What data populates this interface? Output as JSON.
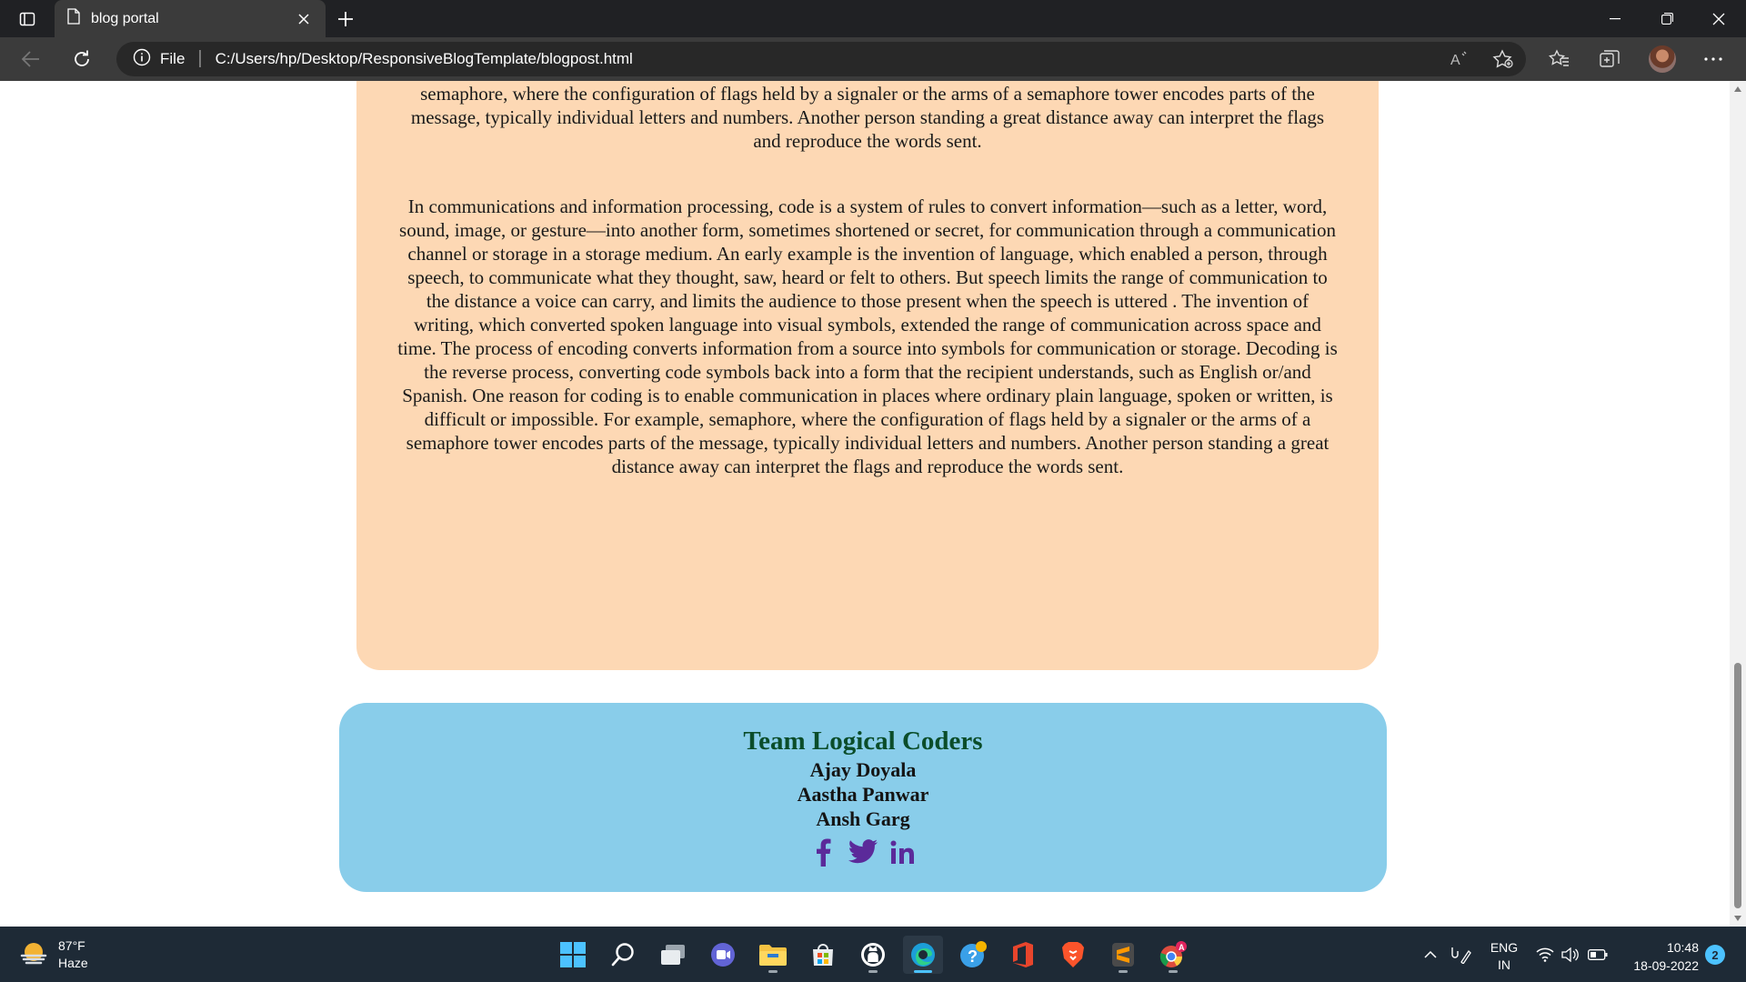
{
  "browser": {
    "tab_title": "blog portal",
    "address_prefix": "File",
    "url": "C:/Users/hp/Desktop/ResponsiveBlogTemplate/blogpost.html"
  },
  "article": {
    "paragraph1": "communication in places where ordinary plain language, spoken or written, is difficult or impossible. For example, semaphore, where the configuration of flags held by a signaler or the arms of a semaphore tower encodes parts of the message, typically individual letters and numbers. Another person standing a great distance away can interpret the flags and reproduce the words sent.",
    "paragraph2": "In communications and information processing, code is a system of rules to convert information—such as a letter, word, sound, image, or gesture—into another form, sometimes shortened or secret, for communication through a communication channel or storage in a storage medium. An early example is the invention of language, which enabled a person, through speech, to communicate what they thought, saw, heard or felt to others. But speech limits the range of communication to the distance a voice can carry, and limits the audience to those present when the speech is uttered . The invention of writing, which converted spoken language into visual symbols, extended the range of communication across space and time. The process of encoding converts information from a source into symbols for communication or storage. Decoding is the reverse process, converting code symbols back into a form that the recipient understands, such as English or/and Spanish. One reason for coding is to enable communication in places where ordinary plain language, spoken or written, is difficult or impossible. For example, semaphore, where the configuration of flags held by a signaler or the arms of a semaphore tower encodes parts of the message, typically individual letters and numbers. Another person standing a great distance away can interpret the flags and reproduce the words sent."
  },
  "footer": {
    "team_name": "Team Logical Coders",
    "members": [
      "Ajay Doyala",
      "Aastha Panwar",
      "Ansh Garg"
    ],
    "social_icons": [
      "facebook-icon",
      "twitter-icon",
      "linkedin-icon"
    ],
    "social_color": "#5b2a9a"
  },
  "taskbar": {
    "weather_temp": "87°F",
    "weather_desc": "Haze",
    "lang_top": "ENG",
    "lang_bottom": "IN",
    "time": "10:48",
    "date": "18-09-2022",
    "notification_count": "2"
  },
  "colors": {
    "article_bg": "#fdd8b4",
    "footer_bg": "#89cdea",
    "team_name": "#0b4d2a",
    "taskbar_bg": "#1e2a36",
    "accent": "#4cc2ff"
  }
}
